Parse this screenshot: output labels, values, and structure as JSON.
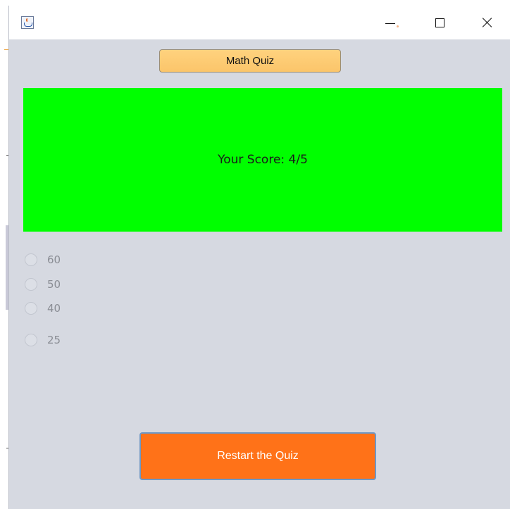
{
  "window": {
    "title": "",
    "icon": "java-cup-icon",
    "controls": {
      "minimize": "minimize-icon",
      "maximize": "maximize-icon",
      "close": "close-icon"
    }
  },
  "header": {
    "quiz_title": "Math Quiz"
  },
  "result": {
    "score_text": "Your Score: 4/5",
    "panel_color": "#00ff00"
  },
  "options": [
    {
      "label": "60",
      "selected": false,
      "enabled": false
    },
    {
      "label": "50",
      "selected": false,
      "enabled": false
    },
    {
      "label": "40",
      "selected": false,
      "enabled": false
    },
    {
      "label": "25",
      "selected": false,
      "enabled": false
    }
  ],
  "actions": {
    "restart_label": "Restart the Quiz",
    "restart_color": "#ff7218"
  },
  "colors": {
    "title_button": "#fbc56a",
    "window_background": "#d6d9e1"
  }
}
